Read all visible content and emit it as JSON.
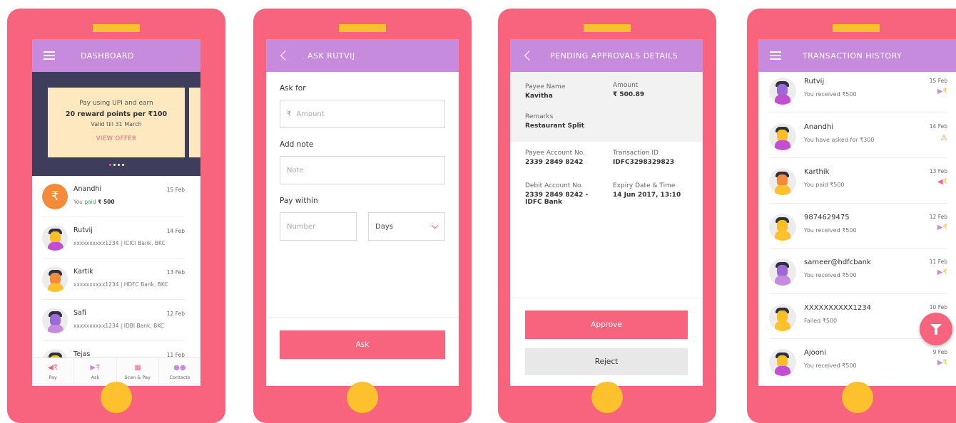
{
  "colors": {
    "phone": "#f8637e",
    "accent": "#fcc12d",
    "header": "#c78bdd",
    "banner": "#3e3d5c",
    "offer_card": "#fde8c0",
    "button": "#f8637e"
  },
  "dashboard": {
    "title": "DASHBOARD",
    "offer": {
      "line1": "Pay using UPI and earn",
      "line2": "20 reward points per ₹100",
      "line3": "Valid till 31 March",
      "cta": "VIEW OFFER"
    },
    "contacts": [
      {
        "name": "Anandhi",
        "date": "15 Feb",
        "sub_prefix": "You ",
        "sub_status": "paid",
        "sub_amount": " ₹ 500"
      },
      {
        "name": "Rutvij",
        "date": "14 Feb",
        "sub": "xxxxxxxxxx1234 | ICICI Bank, BKC"
      },
      {
        "name": "Kartik",
        "date": "13 Feb",
        "sub": "xxxxxxxxxx1234 | HDFC Bank, BKC"
      },
      {
        "name": "Safi",
        "date": "12 Feb",
        "sub": "xxxxxxxxxx1234 | IDBI Bank, BKC"
      },
      {
        "name": "Tejas",
        "date": "11 Feb",
        "sub": ""
      }
    ],
    "tabs": [
      {
        "label": "Pay",
        "icon": "pay-rupee-icon"
      },
      {
        "label": "Ask",
        "icon": "ask-rupee-icon"
      },
      {
        "label": "Scan & Pay",
        "icon": "qr-code-icon"
      },
      {
        "label": "Contacts",
        "icon": "contacts-icon"
      }
    ]
  },
  "ask": {
    "title": "ASK RUTVIJ",
    "ask_for_label": "Ask for",
    "amount_symbol": "₹",
    "amount_placeholder": "Amount",
    "add_note_label": "Add note",
    "note_placeholder": "Note",
    "pay_within_label": "Pay within",
    "number_placeholder": "Number",
    "unit_value": "Days",
    "button": "Ask"
  },
  "pending": {
    "title": "PENDING APPROVALS DETAILS",
    "payee_name_label": "Payee Name",
    "payee_name": "Kavitha",
    "amount_label": "Amount",
    "amount": "₹ 500.89",
    "remarks_label": "Remarks",
    "remarks": "Restaurant Split",
    "payee_account_label": "Payee Account No.",
    "payee_account": "2339 2849 8242",
    "txn_id_label": "Transaction ID",
    "txn_id": "IDFC3298329823",
    "debit_account_label": "Debit Account No.",
    "debit_account_line1": "2339 2849 8242 -",
    "debit_account_line2": "IDFC Bank",
    "expiry_label": "Expiry Date & Time",
    "expiry": "14 Jun 2017, 13:10",
    "approve": "Approve",
    "reject": "Reject"
  },
  "history": {
    "title": "TRANSACTION HISTORY",
    "items": [
      {
        "name": "Rutvij",
        "date": "15 Feb",
        "sub": "You received ₹500",
        "status": "received"
      },
      {
        "name": "Anandhi",
        "date": "14 Feb",
        "sub": "You have asked for ₹300",
        "status": "warning"
      },
      {
        "name": "Karthik",
        "date": "13 Feb",
        "sub": "You paid ₹500",
        "status": "paid"
      },
      {
        "name": "9874629475",
        "date": "12 Feb",
        "sub": "You received ₹500",
        "status": "received"
      },
      {
        "name": "sameer@hdfcbank",
        "date": "11 Feb",
        "sub": "You received ₹500",
        "status": "received"
      },
      {
        "name": "XXXXXXXXXX1234",
        "date": "10 Feb",
        "sub": "Failed ₹500",
        "status": "failed"
      },
      {
        "name": "Ajooni",
        "date": "9 Feb",
        "sub": "You received ₹500",
        "status": "received"
      }
    ]
  }
}
